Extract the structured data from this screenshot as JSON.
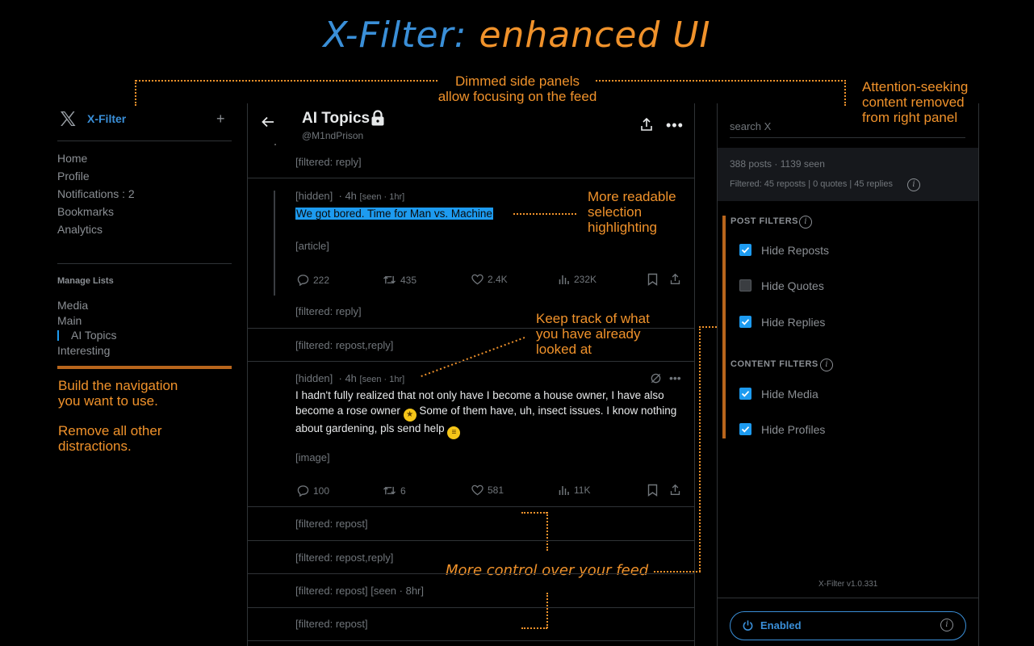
{
  "title": {
    "part1": "X-Filter:",
    "part2": "enhanced UI"
  },
  "annotations": {
    "dimmed_line1": "Dimmed side panels",
    "dimmed_line2": "allow focusing on the feed",
    "attention_line1": "Attention-seeking",
    "attention_line2": "content removed",
    "attention_line3": "from right panel",
    "readable_line1": "More readable",
    "readable_line2": "selection",
    "readable_line3": "highlighting",
    "track_line1": "Keep track of what",
    "track_line2": "you have already",
    "track_line3": "looked at",
    "build_line1": "Build the navigation",
    "build_line2": "you want to use.",
    "remove_line1": "Remove all other",
    "remove_line2": "distractions.",
    "control": "More control over your feed"
  },
  "left": {
    "brand": "X-Filter",
    "plus": "+",
    "nav": [
      "Home",
      "Profile",
      "Notifications : 2",
      "Bookmarks",
      "Analytics"
    ],
    "manage_lists": "Manage Lists",
    "lists": [
      "Media",
      "Main",
      "AI Topics",
      "Interesting"
    ]
  },
  "header": {
    "title": "AI Topics",
    "handle": "@M1ndPrison"
  },
  "feed": {
    "filtered_reply_1": "[filtered: reply]",
    "tweet1": {
      "status": "[hidden]",
      "time": "· 4h",
      "seen": "[seen · 1hr]",
      "text": "We got bored. Time for Man vs. Machine",
      "attachment": "[article]",
      "replies": "222",
      "reposts": "435",
      "likes": "2.4K",
      "views": "232K"
    },
    "filtered_reply_2": "[filtered: reply]",
    "filtered_repost_reply_1": "[filtered: repost,reply]",
    "tweet2": {
      "status": "[hidden]",
      "time": "· 4h",
      "seen": "[seen · 1hr]",
      "text_a": "I hadn't fully realized that not only have I become a house owner, I have also become a rose owner",
      "text_b": "Some of them  have, uh, insect issues. I know nothing about gardening, pls send help",
      "attachment": "[image]",
      "replies": "100",
      "reposts": "6",
      "likes": "581",
      "views": "11K"
    },
    "filtered_repost_1": "[filtered: repost]",
    "filtered_repost_reply_2": "[filtered: repost,reply]",
    "filtered_repost_seen": "[filtered: repost]",
    "filtered_repost_seen_tag": "[seen · 8hr]",
    "filtered_repost_2": "[filtered: repost]"
  },
  "right": {
    "search_placeholder": "search X",
    "stats_line1": "388 posts · 1139 seen",
    "stats_line2": "Filtered: 45 reposts | 0 quotes | 45 replies",
    "post_filters_title": "POST FILTERS",
    "post_filters": [
      {
        "label": "Hide Reposts",
        "checked": true
      },
      {
        "label": "Hide Quotes",
        "checked": false
      },
      {
        "label": "Hide Replies",
        "checked": true
      }
    ],
    "content_filters_title": "CONTENT FILTERS",
    "content_filters": [
      {
        "label": "Hide Media",
        "checked": true
      },
      {
        "label": "Hide Profiles",
        "checked": true
      }
    ],
    "version": "X-Filter v1.0.331",
    "enabled_label": "Enabled"
  },
  "colors": {
    "accent": "#1d9bf0",
    "annotation": "#f0922b",
    "title_blue": "#3a8fd8"
  }
}
